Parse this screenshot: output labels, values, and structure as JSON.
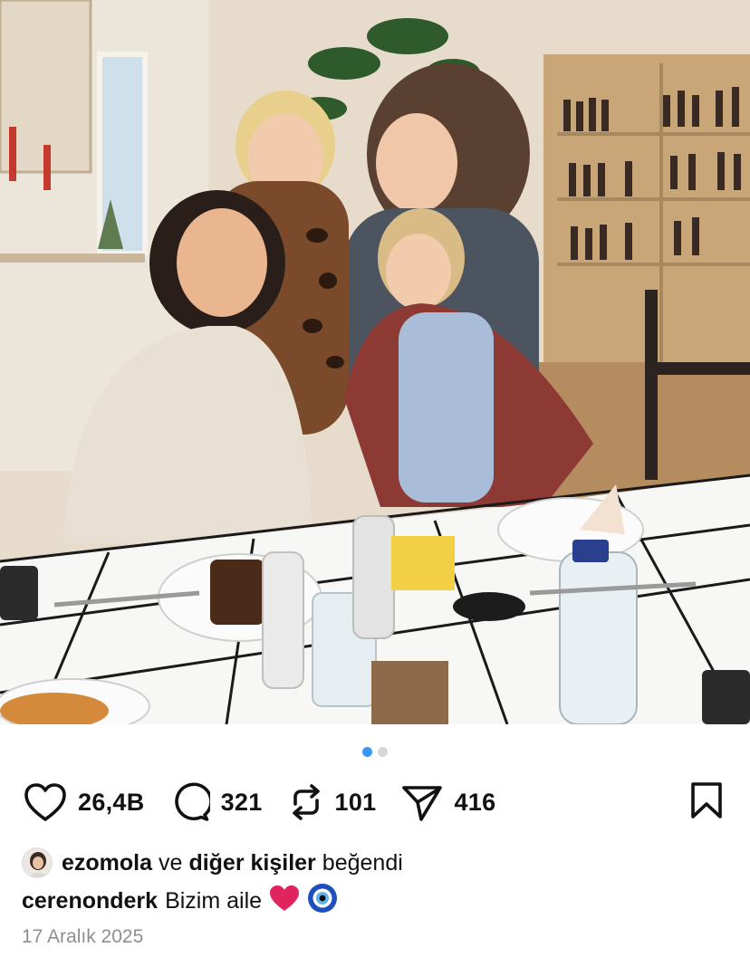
{
  "post": {
    "photo_alt": "",
    "carousel": {
      "total": 2,
      "active": 0
    },
    "actions": {
      "likes": "26,4B",
      "comments": "321",
      "reposts": "101",
      "shares": "416"
    },
    "liked_by": {
      "user": "ezomola",
      "connector": "ve",
      "others": "diğer kişiler",
      "suffix": "beğendi"
    },
    "caption": {
      "username": "cerenonderk",
      "text": "Bizim aile"
    },
    "date": "17 Aralık 2025"
  },
  "icons": {
    "like": "heart-icon",
    "comment": "comment-bubble-icon",
    "repost": "repost-arrows-icon",
    "share": "paper-plane-icon",
    "save": "bookmark-icon",
    "caption_emoji_1": "red-heart-emoji",
    "caption_emoji_2": "nazar-eye-emoji"
  },
  "colors": {
    "carousel_active": "#3897f0",
    "carousel_inactive": "#d6d6d6",
    "date_gray": "#8e8e8e"
  }
}
